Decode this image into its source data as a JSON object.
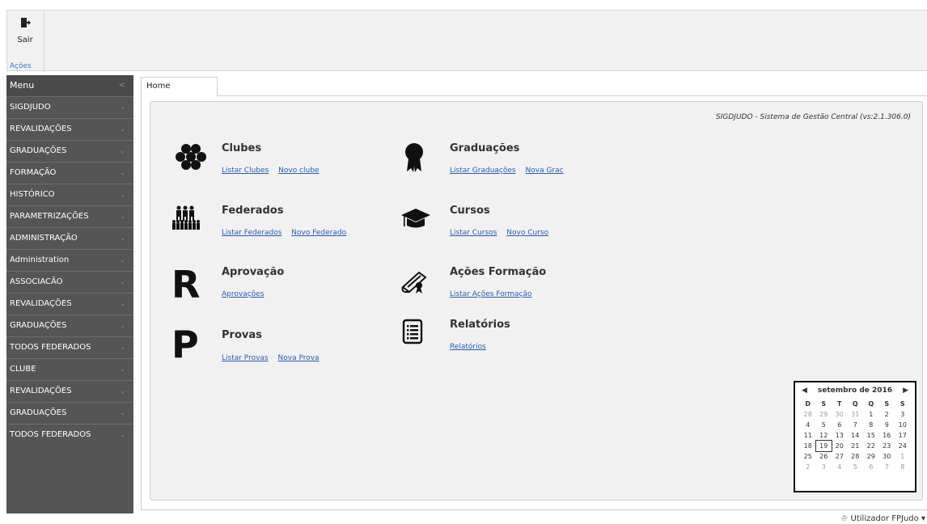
{
  "ribbon": {
    "exit_label": "Sair",
    "group_label": "Ações"
  },
  "sidebar": {
    "header": "Menu",
    "items": [
      {
        "label": "SIGDJUDO"
      },
      {
        "label": "REVALIDAÇÕES"
      },
      {
        "label": "GRADUAÇÕES"
      },
      {
        "label": "FORMAÇÃO"
      },
      {
        "label": "HISTÓRICO"
      },
      {
        "label": "PARAMETRIZAÇÕES"
      },
      {
        "label": "ADMINISTRAÇÃO"
      },
      {
        "label": "Administration"
      },
      {
        "label": "ASSOCIACÃO"
      },
      {
        "label": "REVALIDAÇÕES"
      },
      {
        "label": "GRADUAÇÕES"
      },
      {
        "label": "TODOS FEDERADOS"
      },
      {
        "label": "CLUBE"
      },
      {
        "label": "REVALIDAÇÕES"
      },
      {
        "label": "GRADUAÇÕES"
      },
      {
        "label": "TODOS FEDERADOS"
      }
    ]
  },
  "tab": {
    "label": "Home"
  },
  "main": {
    "system_title": "SIGDJUDO - Sistema de Gestão Central  (vs:2.1.306.0)",
    "tiles": {
      "clubes": {
        "title": "Clubes",
        "icon": "group-icon",
        "links": [
          "Listar Clubes",
          "Novo clube"
        ]
      },
      "federados": {
        "title": "Federados",
        "icon": "people-icon",
        "links": [
          "Listar Federados",
          "Novo Federado"
        ]
      },
      "aprovacao": {
        "title": "Aprovação",
        "icon": "letter-r-icon",
        "links": [
          "Aprovações"
        ]
      },
      "provas": {
        "title": "Provas",
        "icon": "letter-p-icon",
        "links": [
          "Listar Provas",
          "Nova Prova"
        ]
      },
      "graduacoes": {
        "title": "Graduações",
        "icon": "award-icon",
        "links": [
          "Listar Graduações",
          "Nova Grac"
        ]
      },
      "cursos": {
        "title": "Cursos",
        "icon": "graduation-cap-icon",
        "links": [
          "Listar Cursos",
          "Novo Curso"
        ]
      },
      "acoes_formacao": {
        "title": "Ações Formação",
        "icon": "diploma-icon",
        "links": [
          "Listar Ações Formação"
        ]
      },
      "relatorios": {
        "title": "Relatórios",
        "icon": "list-document-icon",
        "links": [
          "Relatórios"
        ]
      }
    }
  },
  "calendar": {
    "month_label": "setembro de 2016",
    "days_of_week": [
      "D",
      "S",
      "T",
      "Q",
      "Q",
      "S",
      "S"
    ],
    "weeks": [
      [
        "28",
        "29",
        "30",
        "31",
        "1",
        "2",
        "3"
      ],
      [
        "4",
        "5",
        "6",
        "7",
        "8",
        "9",
        "10"
      ],
      [
        "11",
        "12",
        "13",
        "14",
        "15",
        "16",
        "17"
      ],
      [
        "18",
        "19",
        "20",
        "21",
        "22",
        "23",
        "24"
      ],
      [
        "25",
        "26",
        "27",
        "28",
        "29",
        "30",
        "1"
      ],
      [
        "2",
        "3",
        "4",
        "5",
        "6",
        "7",
        "8"
      ]
    ],
    "today": "19"
  },
  "status": {
    "user_label": "Utilizador FPJudo"
  }
}
